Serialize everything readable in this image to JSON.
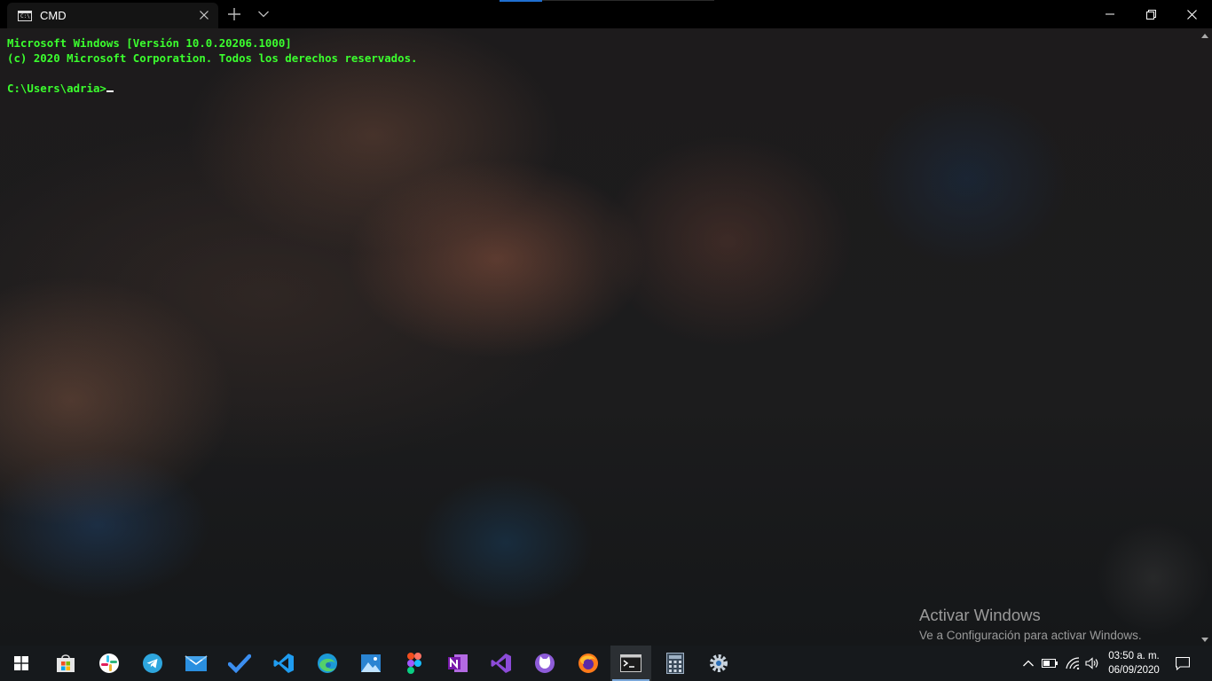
{
  "window": {
    "tab_title": "CMD",
    "tab_icon_text": "C:\\."
  },
  "terminal": {
    "lines": [
      "Microsoft Windows [Versión 10.0.20206.1000]",
      "(c) 2020 Microsoft Corporation. Todos los derechos reservados.",
      "",
      "C:\\Users\\adria>"
    ],
    "text_color": "#3bff2e"
  },
  "watermark": {
    "title": "Activar Windows",
    "subtitle": "Ve a Configuración para activar Windows."
  },
  "taskbar": {
    "apps": [
      "start-icon",
      "store-icon",
      "slack-icon",
      "telegram-icon",
      "mail-icon",
      "todo-icon",
      "vscode-icon",
      "edge-icon",
      "photos-icon",
      "figma-icon",
      "onenote-icon",
      "visual-studio-icon",
      "github-desktop-icon",
      "firefox-icon",
      "terminal-icon",
      "calculator-icon",
      "settings-icon"
    ],
    "active_app": "terminal-icon",
    "clock_time": "03:50 a. m.",
    "clock_date": "06/09/2020"
  },
  "colors": {
    "accent": "#1f6fd1",
    "taskbar_bg": "#16191c",
    "titlebar_bg": "#000000"
  }
}
